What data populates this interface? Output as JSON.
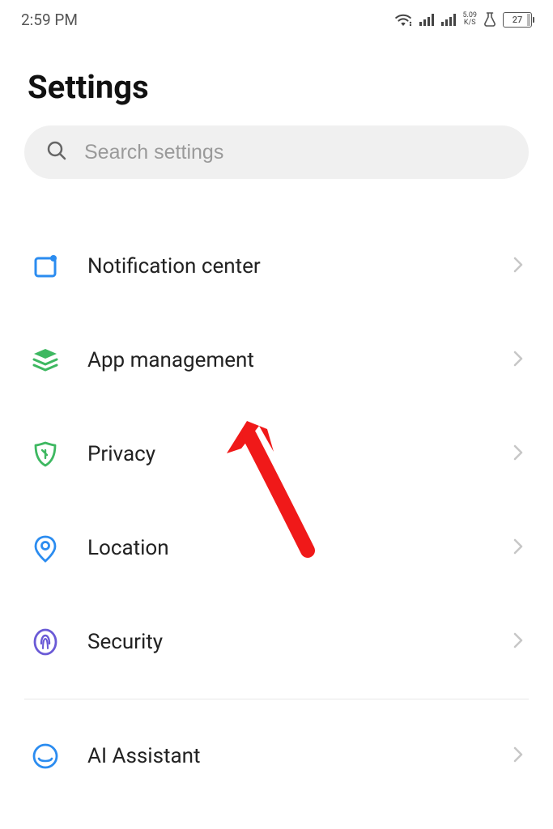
{
  "status": {
    "time": "2:59 PM",
    "speed_top": "5.09",
    "speed_unit": "K/S",
    "battery": "27"
  },
  "header": {
    "title": "Settings"
  },
  "search": {
    "placeholder": "Search settings"
  },
  "items": [
    {
      "label": "Notification center"
    },
    {
      "label": "App management"
    },
    {
      "label": "Privacy"
    },
    {
      "label": "Location"
    },
    {
      "label": "Security"
    }
  ],
  "items2": [
    {
      "label": "AI Assistant"
    }
  ]
}
